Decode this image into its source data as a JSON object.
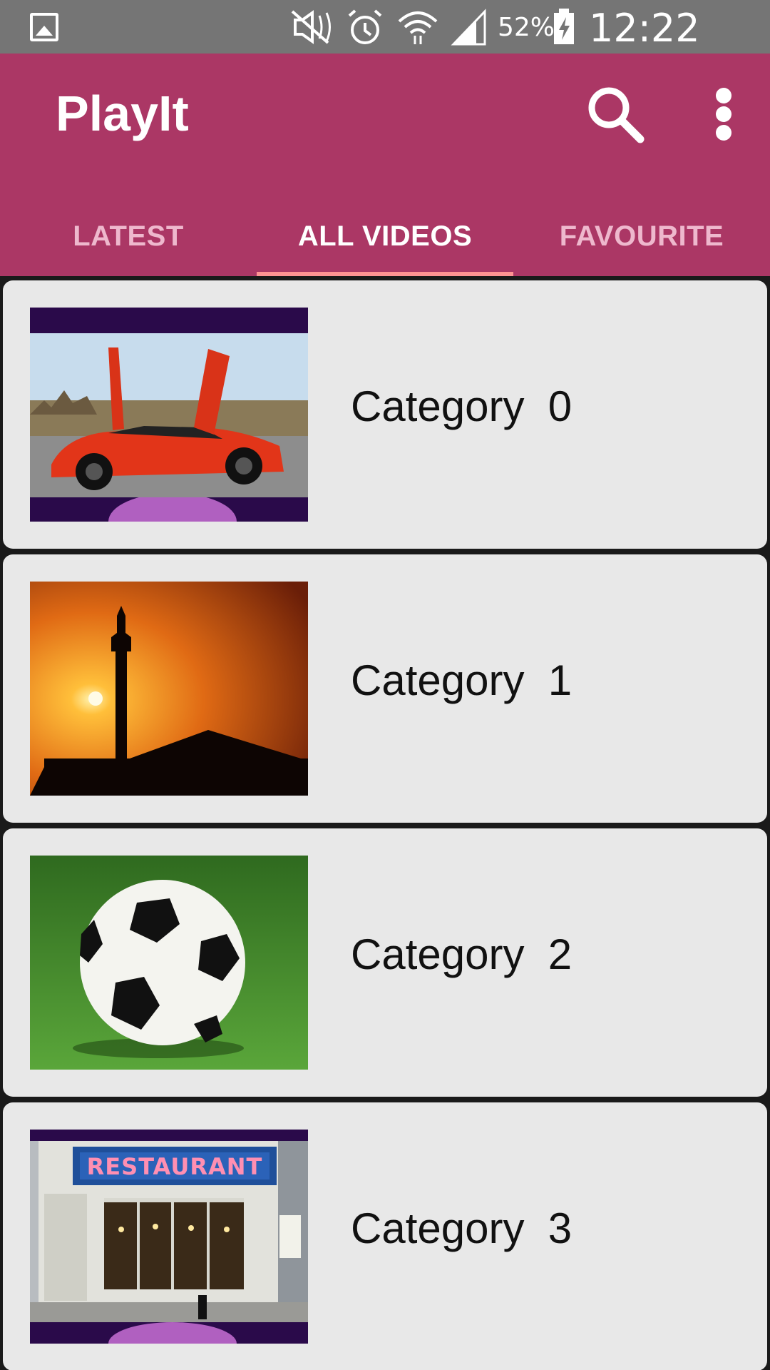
{
  "status_bar": {
    "icons": [
      "gallery-icon",
      "mute-icon",
      "alarm-icon",
      "wifi-icon",
      "signal-icon",
      "battery-charging-icon"
    ],
    "battery": "52%",
    "time": "12:22 pm"
  },
  "app_bar": {
    "title": "PlayIt",
    "actions": [
      "search-icon",
      "more-vert-icon"
    ]
  },
  "tabs": [
    {
      "label": "LATEST",
      "active": false
    },
    {
      "label": "ALL VIDEOS",
      "active": true
    },
    {
      "label": "FAVOURITE",
      "active": false
    }
  ],
  "categories": [
    {
      "label": "Category  0",
      "thumbnail": "red sports car"
    },
    {
      "label": "Category  1",
      "thumbnail": "minaret at sunset"
    },
    {
      "label": "Category  2",
      "thumbnail": "soccer ball on grass"
    },
    {
      "label": "Category  3",
      "thumbnail": "restaurant storefront"
    }
  ],
  "colors": {
    "app_bar": "#ab3765",
    "status_bar": "#757575",
    "tab_indicator": "#ff9393",
    "card": "#e8e8e8"
  }
}
